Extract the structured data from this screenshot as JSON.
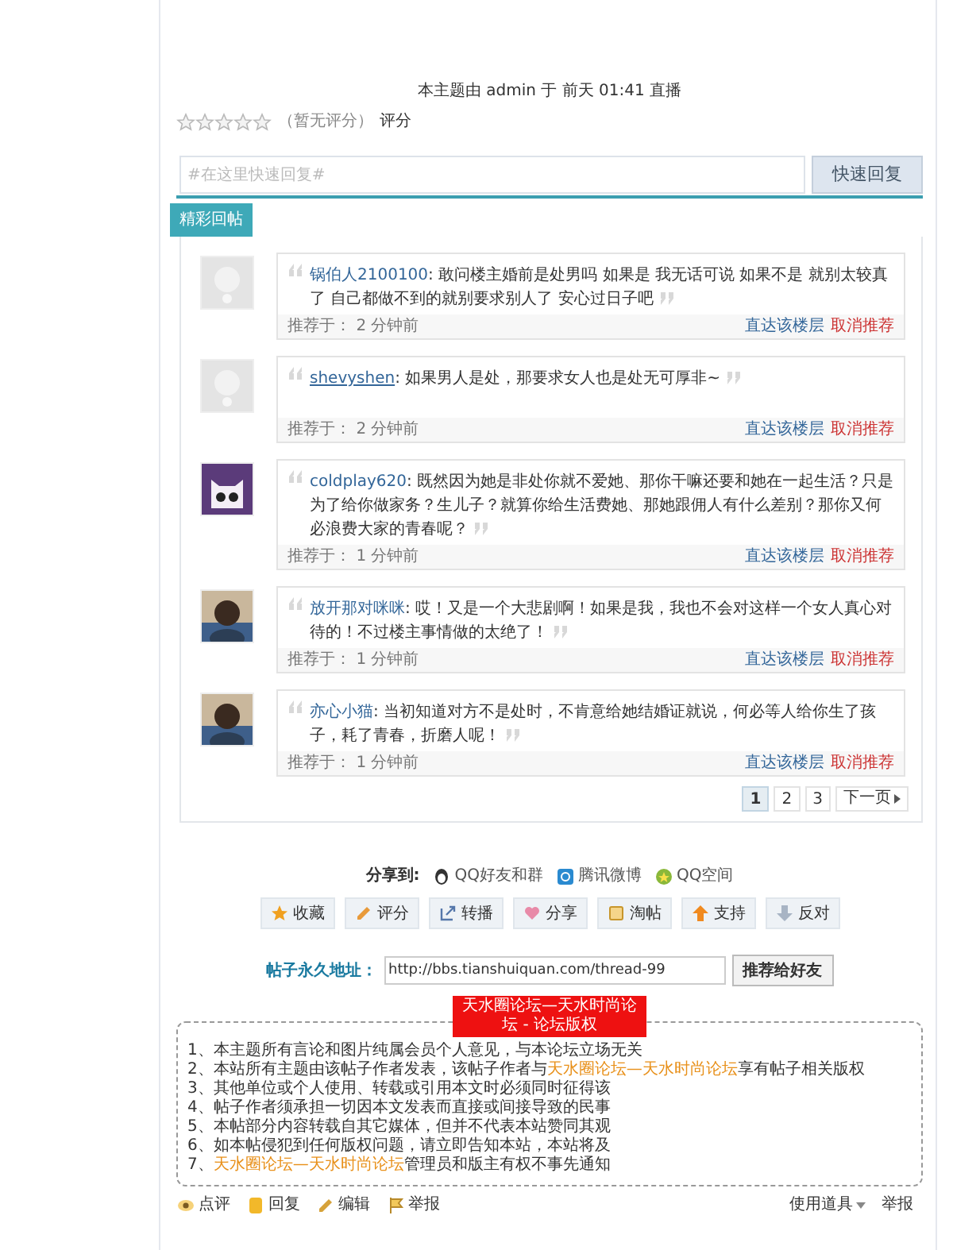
{
  "moderation": "本主题由 admin 于 前天 01:41 直播",
  "rating": {
    "stars": 0,
    "note": "（暂无评分）",
    "link": "评分"
  },
  "quick_reply": {
    "placeholder": "#在这里快速回复#",
    "button": "快速回复"
  },
  "tab": {
    "label": "精彩回帖"
  },
  "comments": [
    {
      "avatar": {
        "kind": "blank"
      },
      "author": "锅伯人2100100",
      "underline": false,
      "text": ": 敢问楼主婚前是处男吗 如果是 我无话可说 如果不是 就别太较真了 自己都做不到的就别要求别人了 安心过日子吧",
      "label": "推荐于：",
      "time": "2 分钟前",
      "goto": "直达该楼层",
      "cancel": "取消推荐"
    },
    {
      "avatar": {
        "kind": "blank"
      },
      "author": "shevyshen",
      "underline": true,
      "text": ": 如果男人是处，那要求女人也是处无可厚非~",
      "label": "推荐于：",
      "time": "2 分钟前",
      "goto": "直达该楼层",
      "cancel": "取消推荐"
    },
    {
      "avatar": {
        "kind": "cat"
      },
      "author": "coldplay620",
      "underline": false,
      "text": ": 既然因为她是非处你就不爱她、那你干嘛还要和她在一起生活？只是为了给你做家务？生儿子？就算你给生活费她、那她跟佣人有什么差别？那你又何必浪费大家的青春呢？",
      "label": "推荐于：",
      "time": "1 分钟前",
      "goto": "直达该楼层",
      "cancel": "取消推荐"
    },
    {
      "author": "放开那对咪咪",
      "underline": false,
      "text": ": 哎！又是一个大悲剧啊！如果是我，我也不会对这样一个女人真心对待的！不过楼主事情做的太绝了！",
      "label": "推荐于：",
      "time": "1 分钟前",
      "goto": "直达该楼层",
      "cancel": "取消推荐"
    },
    {
      "author": "亦心小猫",
      "underline": false,
      "text": ": 当初知道对方不是处时，不肯意给她结婚证就说，何必等人给你生了孩子，耗了青春，折磨人呢！",
      "label": "推荐于：",
      "time": "1 分钟前",
      "goto": "直达该楼层",
      "cancel": "取消推荐"
    }
  ],
  "pagination": {
    "pages": [
      {
        "label": "1",
        "selected": true
      },
      {
        "label": "2",
        "selected": false
      },
      {
        "label": "3",
        "selected": false
      }
    ],
    "next": "下一页"
  },
  "share": {
    "label": "分享到:",
    "targets": [
      {
        "kind": "qq",
        "label": "QQ好友和群"
      },
      {
        "kind": "weibo",
        "label": "腾讯微博"
      },
      {
        "kind": "qzone",
        "label": "QQ空间"
      }
    ]
  },
  "actions": [
    {
      "kind": "star",
      "label": "收藏"
    },
    {
      "kind": "rate",
      "label": "评分"
    },
    {
      "kind": "forward",
      "label": "转播"
    },
    {
      "kind": "heart",
      "label": "分享"
    },
    {
      "kind": "bag",
      "label": "淘帖"
    },
    {
      "kind": "up",
      "label": "支持"
    },
    {
      "kind": "down",
      "label": "反对"
    }
  ],
  "permalink": {
    "label": "帖子永久地址：",
    "value": "http://bbs.tianshuiquan.com/thread-99",
    "button": "推荐给好友"
  },
  "copyright": {
    "title": "天水圈论坛—天水时尚论坛 - 论坛版权",
    "lines": [
      [
        {
          "text": "1、本主题所有言论和图片纯属会员个人意见，与本论坛立场无关",
          "highlight": false
        }
      ],
      [
        {
          "text": "2、本站所有主题由该帖子作者发表，该帖子作者与",
          "highlight": false
        },
        {
          "text": "天水圈论坛—天水时尚论坛",
          "highlight": true
        },
        {
          "text": "享有帖子相关版权",
          "highlight": false
        }
      ],
      [
        {
          "text": "3、其他单位或个人使用、转载或引用本文时必须同时征得该",
          "highlight": false
        }
      ],
      [
        {
          "text": "4、帖子作者须承担一切因本文发表而直接或间接导致的民事",
          "highlight": false
        }
      ],
      [
        {
          "text": "5、本帖部分内容转载自其它媒体，但并不代表本站赞同其观",
          "highlight": false
        }
      ],
      [
        {
          "text": "6、如本帖侵犯到任何版权问题，请立即告知本站，本站将及",
          "highlight": false
        }
      ],
      [
        {
          "text": "7、",
          "highlight": false
        },
        {
          "text": "天水圈论坛—天水时尚论坛",
          "highlight": true
        },
        {
          "text": "管理员和版主有权不事先通知",
          "highlight": false
        }
      ]
    ]
  },
  "footer": {
    "left": [
      {
        "kind": "eye",
        "label": "点评"
      },
      {
        "kind": "reply",
        "label": "回复"
      },
      {
        "kind": "edit",
        "label": "编辑"
      },
      {
        "kind": "report",
        "label": "举报"
      }
    ],
    "tools": "使用道具",
    "report": "举报"
  }
}
